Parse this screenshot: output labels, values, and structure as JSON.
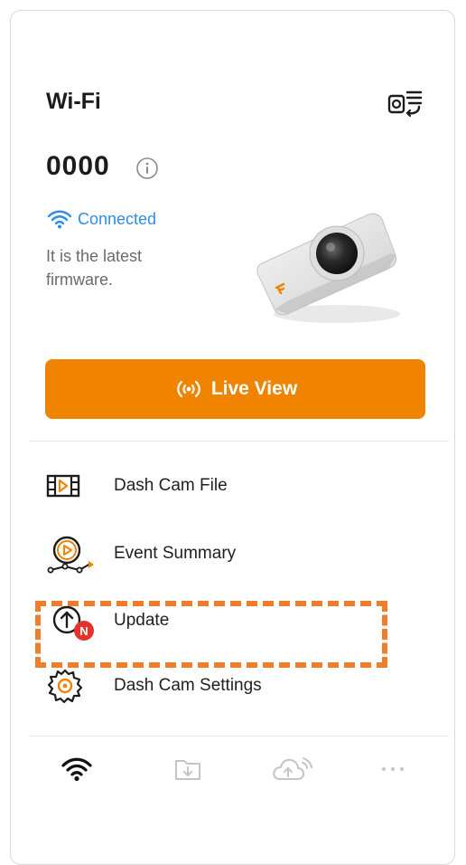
{
  "header": {
    "title": "Wi-Fi",
    "device_switch_icon": "device-switch-icon"
  },
  "device": {
    "name": "0000",
    "info_icon": "info-icon",
    "status": "Connected",
    "firmware_message": "It is the latest firmware."
  },
  "live_view": {
    "label": "Live View",
    "icon": "broadcast-icon"
  },
  "menu": [
    {
      "label": "Dash Cam File",
      "icon": "film-icon"
    },
    {
      "label": "Event Summary",
      "icon": "event-play-icon"
    },
    {
      "label": "Update",
      "icon": "upload-arrow-icon",
      "badge": "N"
    },
    {
      "label": "Dash Cam Settings",
      "icon": "gear-icon"
    }
  ],
  "bottom_nav": [
    {
      "icon": "wifi-icon",
      "active": true
    },
    {
      "icon": "folder-download-icon",
      "active": false
    },
    {
      "icon": "cloud-upload-icon",
      "active": false
    },
    {
      "icon": "more-icon",
      "active": false
    }
  ],
  "colors": {
    "accent": "#f08300",
    "link": "#2f8ce6",
    "highlight": "#ef7d2a",
    "badge": "#e5322d"
  }
}
